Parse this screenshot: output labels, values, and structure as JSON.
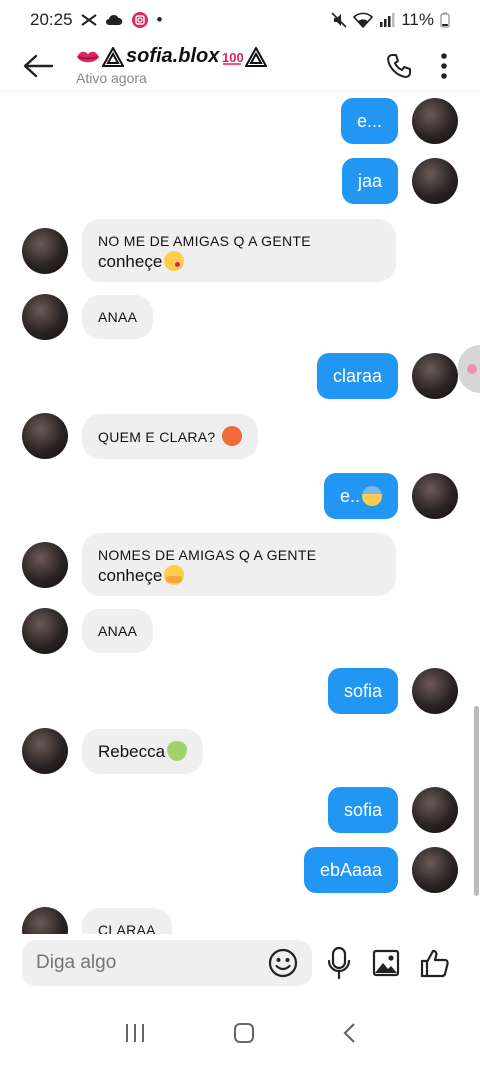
{
  "status_bar": {
    "time": "20:25",
    "battery": "11%",
    "dot": "•"
  },
  "header": {
    "name": "sofia.blox",
    "status": "Ativo agora",
    "accent_color": "#e0245e",
    "icons": [
      "back-arrow-icon",
      "lips-icon",
      "hundred-points-icon",
      "phone-icon",
      "more-vertical-icon"
    ]
  },
  "messages": [
    {
      "dir": "out",
      "text": "e..."
    },
    {
      "dir": "out",
      "text": "jaa"
    },
    {
      "dir": "in",
      "line1": "NO ME DE AMIGAS Q A GENTE",
      "line2": "conheçe",
      "emoji": "kissing-face-icon"
    },
    {
      "dir": "in",
      "text": "ANAA"
    },
    {
      "dir": "out",
      "text": "claraa"
    },
    {
      "dir": "in",
      "text": "QUEM E CLARA?",
      "emoji": "angry-face-icon"
    },
    {
      "dir": "out",
      "text": "e..",
      "emoji": "anxious-face-icon"
    },
    {
      "dir": "in",
      "line1": "NOMES DE AMIGAS Q A GENTE",
      "line2": "conheçe",
      "emoji": "hugging-face-icon"
    },
    {
      "dir": "in",
      "text": "ANAA"
    },
    {
      "dir": "out",
      "text": "sofia"
    },
    {
      "dir": "in",
      "text": "Rebecca",
      "emoji": "alien-icon"
    },
    {
      "dir": "out",
      "text": "sofia"
    },
    {
      "dir": "out",
      "text": "ebAaaa"
    },
    {
      "dir": "in",
      "text": "CLARAA"
    }
  ],
  "composer": {
    "placeholder": "Diga algo"
  },
  "colors": {
    "outgoing_bubble": "#2196f3",
    "incoming_bubble": "#efefef"
  }
}
